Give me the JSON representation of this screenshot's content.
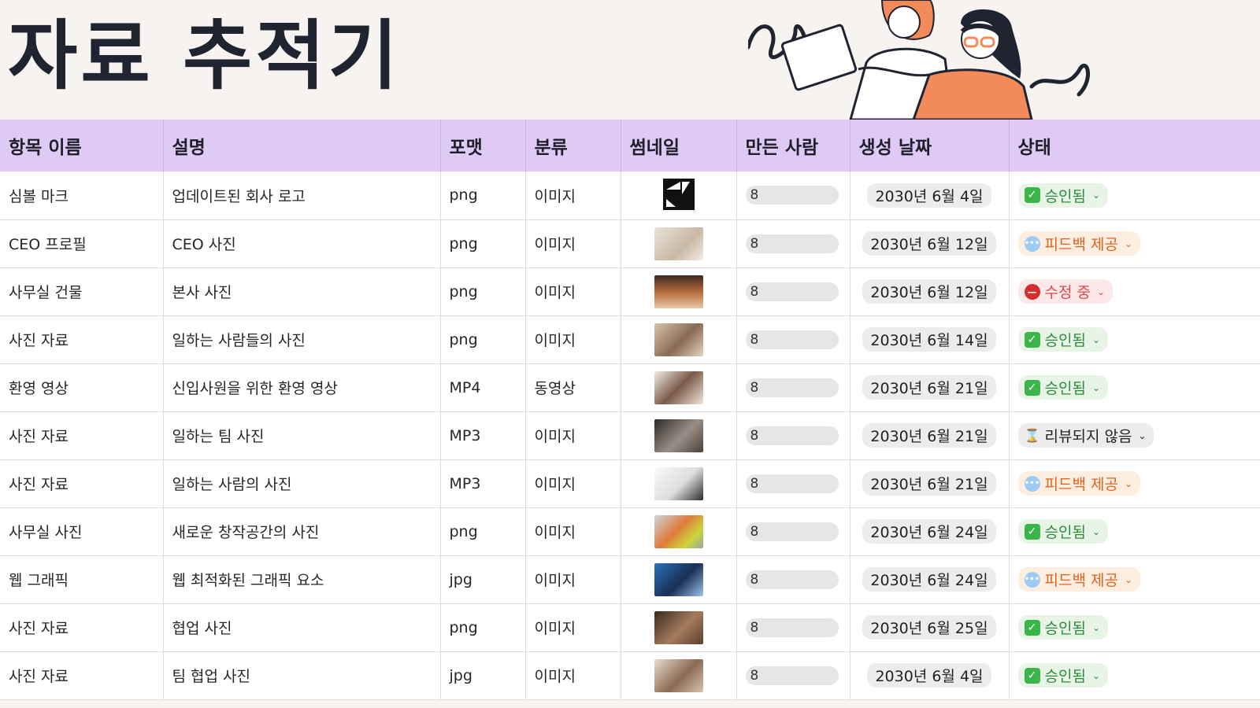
{
  "page": {
    "title": "자료 추적기"
  },
  "table": {
    "headers": [
      "항목 이름",
      "설명",
      "포맷",
      "분류",
      "썸네일",
      "만든 사람",
      "생성 날짜",
      "상태"
    ],
    "rows": [
      {
        "name": "심볼 마크",
        "desc": "업데이트된 회사 로고",
        "format": "png",
        "category": "이미지",
        "thumb": "logo",
        "creator": "8",
        "date": "2030년 6월 4일",
        "status": "승인됨",
        "status_type": "approved"
      },
      {
        "name": "CEO 프로필",
        "desc": "CEO 사진",
        "format": "png",
        "category": "이미지",
        "thumb": "photo-light",
        "creator": "8",
        "date": "2030년 6월 12일",
        "status": "피드백 제공",
        "status_type": "feedback"
      },
      {
        "name": "사무실 건물",
        "desc": "본사 사진",
        "format": "png",
        "category": "이미지",
        "thumb": "photo-warm",
        "creator": "8",
        "date": "2030년 6월 12일",
        "status": "수정 중",
        "status_type": "editing"
      },
      {
        "name": "사진 자료",
        "desc": "일하는 사람들의 사진",
        "format": "png",
        "category": "이미지",
        "thumb": "photo-beige",
        "creator": "8",
        "date": "2030년 6월 14일",
        "status": "승인됨",
        "status_type": "approved"
      },
      {
        "name": "환영 영상",
        "desc": "신입사원을 위한 환영 영상",
        "format": "MP4",
        "category": "동영상",
        "thumb": "photo-people",
        "creator": "8",
        "date": "2030년 6월 21일",
        "status": "승인됨",
        "status_type": "approved"
      },
      {
        "name": "사진 자료",
        "desc": "일하는 팀 사진",
        "format": "MP3",
        "category": "이미지",
        "thumb": "photo-dark",
        "creator": "8",
        "date": "2030년 6월 21일",
        "status": "리뷰되지 않음",
        "status_type": "unreviewed"
      },
      {
        "name": "사진 자료",
        "desc": "일하는 사람의 사진",
        "format": "MP3",
        "category": "이미지",
        "thumb": "photo-white",
        "creator": "8",
        "date": "2030년 6월 21일",
        "status": "피드백 제공",
        "status_type": "feedback"
      },
      {
        "name": "사무실 사진",
        "desc": "새로운 창작공간의 사진",
        "format": "png",
        "category": "이미지",
        "thumb": "photo-office",
        "creator": "8",
        "date": "2030년 6월 24일",
        "status": "승인됨",
        "status_type": "approved"
      },
      {
        "name": "웹 그래픽",
        "desc": "웹 최적화된 그래픽 요소",
        "format": "jpg",
        "category": "이미지",
        "thumb": "photo-blue",
        "creator": "8",
        "date": "2030년 6월 24일",
        "status": "피드백 제공",
        "status_type": "feedback"
      },
      {
        "name": "사진 자료",
        "desc": "협업 사진",
        "format": "png",
        "category": "이미지",
        "thumb": "photo-brown",
        "creator": "8",
        "date": "2030년 6월 25일",
        "status": "승인됨",
        "status_type": "approved"
      },
      {
        "name": "사진 자료",
        "desc": "팀 협업 사진",
        "format": "jpg",
        "category": "이미지",
        "thumb": "photo-team",
        "creator": "8",
        "date": "2030년 6월 4일",
        "status": "승인됨",
        "status_type": "approved"
      }
    ]
  }
}
